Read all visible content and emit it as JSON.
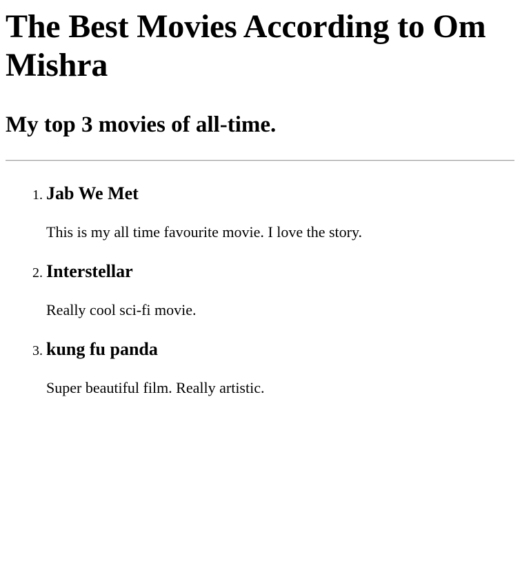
{
  "page": {
    "title": "The Best Movies According to Om Mishra",
    "subtitle": "My top 3 movies of all-time."
  },
  "movies": [
    {
      "title": "Jab We Met",
      "description": "This is my all time favourite movie. I love the story."
    },
    {
      "title": "Interstellar",
      "description": "Really cool sci-fi movie."
    },
    {
      "title": "kung fu panda",
      "description": "Super beautiful film. Really artistic."
    }
  ]
}
